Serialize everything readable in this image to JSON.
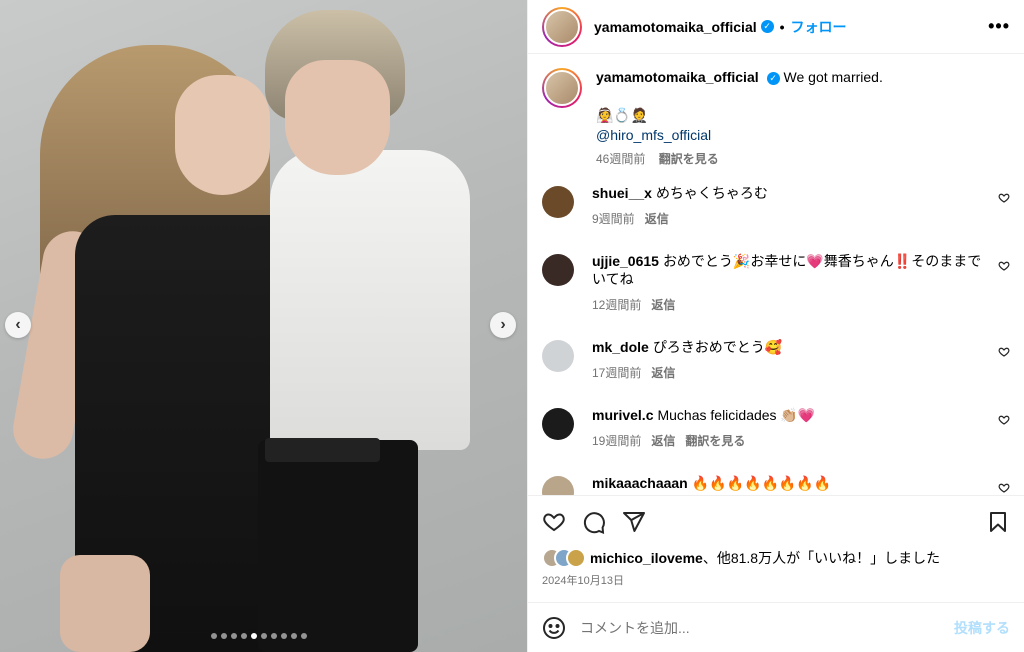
{
  "header": {
    "username": "yamamotomaika_official",
    "separator": "•",
    "follow_label": "フォロー",
    "more_label": "•••"
  },
  "caption": {
    "username": "yamamotomaika_official",
    "text": "We got married.",
    "emojis": "👰💍🤵",
    "mention": "@hiro_mfs_official",
    "time": "46週間前",
    "translate": "翻訳を見る"
  },
  "comments": [
    {
      "user": "shuei__x",
      "text": "めちゃくちゃろむ",
      "time": "9週間前",
      "reply": "返信",
      "avatar_color": "#6b4a2a"
    },
    {
      "user": "ujjie_0615",
      "text": "おめでとう🎉お幸せに💗舞香ちゃん‼️そのままでいてね",
      "time": "12週間前",
      "reply": "返信",
      "avatar_color": "#3a2a26"
    },
    {
      "user": "mk_dole",
      "text": "ぴろきおめでとう🥰",
      "time": "17週間前",
      "reply": "返信",
      "avatar_color": "#d0d3d6"
    },
    {
      "user": "murivel.c",
      "text": "Muchas felicidades 👏🏼💗",
      "time": "19週間前",
      "reply": "返信",
      "translate": "翻訳を見る",
      "avatar_color": "#1b1b1b"
    },
    {
      "user": "mikaaachaaan",
      "text": "🔥🔥🔥🔥🔥🔥🔥🔥",
      "avatar_color": "#b9a58a"
    }
  ],
  "likes": {
    "user": "michico_iloveme",
    "rest": "、他81.8万人が「いいね！」しました"
  },
  "date": "2024年10月13日",
  "add_comment": {
    "placeholder": "コメントを追加...",
    "post_label": "投稿する"
  },
  "media": {
    "nav_prev": "‹",
    "nav_next": "›",
    "slide_count": 10,
    "active_slide": 5
  },
  "colors": {
    "accent": "#0095f6",
    "muted": "#737373",
    "link": "#00376b"
  }
}
